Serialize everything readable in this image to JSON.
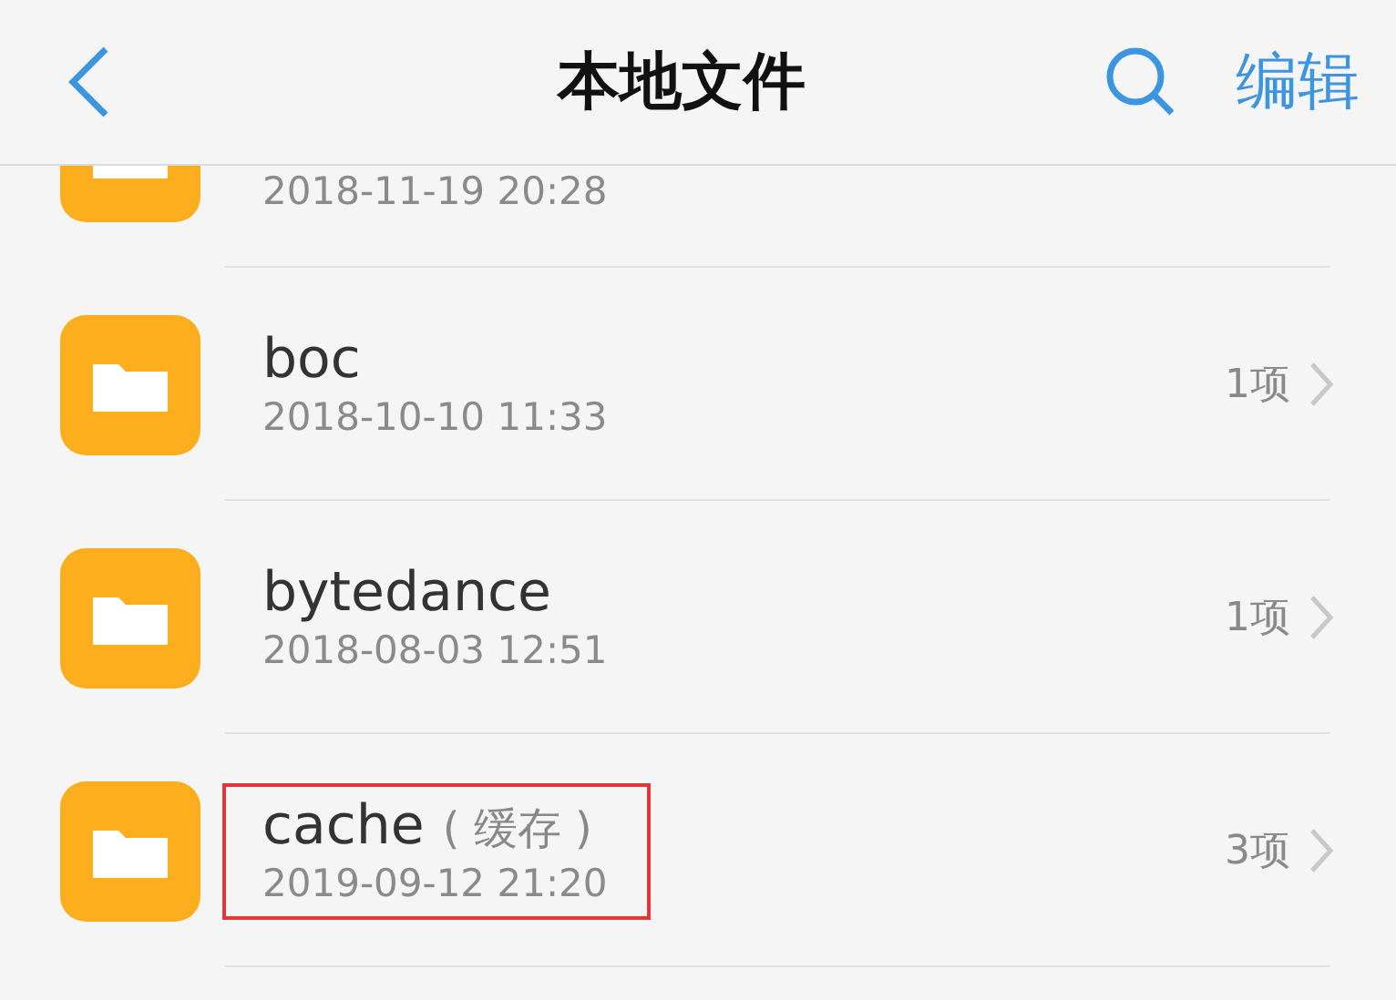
{
  "header": {
    "title": "本地文件",
    "action": "编辑"
  },
  "items": [
    {
      "date": "2018-11-19 20:28",
      "highlighted": false
    },
    {
      "name": "boc",
      "date": "2018-10-10 11:33",
      "count": "1项",
      "highlighted": false
    },
    {
      "name": "bytedance",
      "date": "2018-08-03 12:51",
      "count": "1项",
      "highlighted": false
    },
    {
      "name": "cache",
      "note": "( 缓存 )",
      "date": "2019-09-12 21:20",
      "count": "3项",
      "highlighted": true
    }
  ]
}
